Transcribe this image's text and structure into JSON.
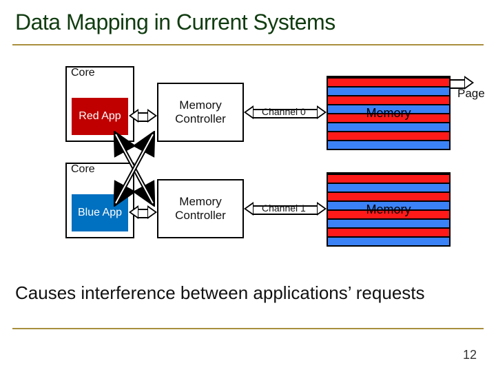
{
  "slide": {
    "title": "Data Mapping in Current Systems",
    "conclusion": "Causes interference between applications’ requests",
    "page_number": "12"
  },
  "labels": {
    "core_top": "Core",
    "core_bottom": "Core",
    "app_red": "Red App",
    "app_blue": "Blue App",
    "mc_top": "Memory Controller",
    "mc_bottom": "Memory Controller",
    "ch0": "Channel 0",
    "ch1": "Channel 1",
    "mem_top": "Memory",
    "mem_bottom": "Memory",
    "page_annotation": "Page"
  },
  "memory_stripes": {
    "top": [
      "red",
      "blue",
      "red",
      "blue",
      "red",
      "blue",
      "red",
      "blue"
    ],
    "bottom": [
      "red",
      "blue",
      "red",
      "blue",
      "red",
      "blue",
      "red",
      "blue"
    ]
  },
  "chart_data": {
    "type": "diagram",
    "nodes": [
      {
        "id": "core0",
        "label": "Core",
        "contains": "Red App",
        "pos": "top-left"
      },
      {
        "id": "core1",
        "label": "Core",
        "contains": "Blue App",
        "pos": "bottom-left"
      },
      {
        "id": "mc0",
        "label": "Memory Controller",
        "pos": "top-center"
      },
      {
        "id": "mc1",
        "label": "Memory Controller",
        "pos": "bottom-center"
      },
      {
        "id": "mem0",
        "label": "Memory",
        "pos": "top-right",
        "rows": 8,
        "pattern": "alternating red/blue"
      },
      {
        "id": "mem1",
        "label": "Memory",
        "pos": "bottom-right",
        "rows": 8,
        "pattern": "alternating red/blue"
      }
    ],
    "edges": [
      {
        "from": "core0",
        "to": "mc0",
        "kind": "bidirectional"
      },
      {
        "from": "core1",
        "to": "mc1",
        "kind": "bidirectional"
      },
      {
        "from": "core0",
        "to": "mc1",
        "kind": "crossbar"
      },
      {
        "from": "core1",
        "to": "mc0",
        "kind": "crossbar"
      },
      {
        "from": "mc0",
        "to": "mem0",
        "kind": "bidirectional",
        "label": "Channel 0"
      },
      {
        "from": "mc1",
        "to": "mem1",
        "kind": "bidirectional",
        "label": "Channel 1"
      }
    ],
    "annotations": [
      {
        "text": "Page",
        "points_to": "mem0 top row",
        "arrow": "single"
      }
    ],
    "title": "Data Mapping in Current Systems",
    "caption": "Causes interference between applications’ requests"
  }
}
